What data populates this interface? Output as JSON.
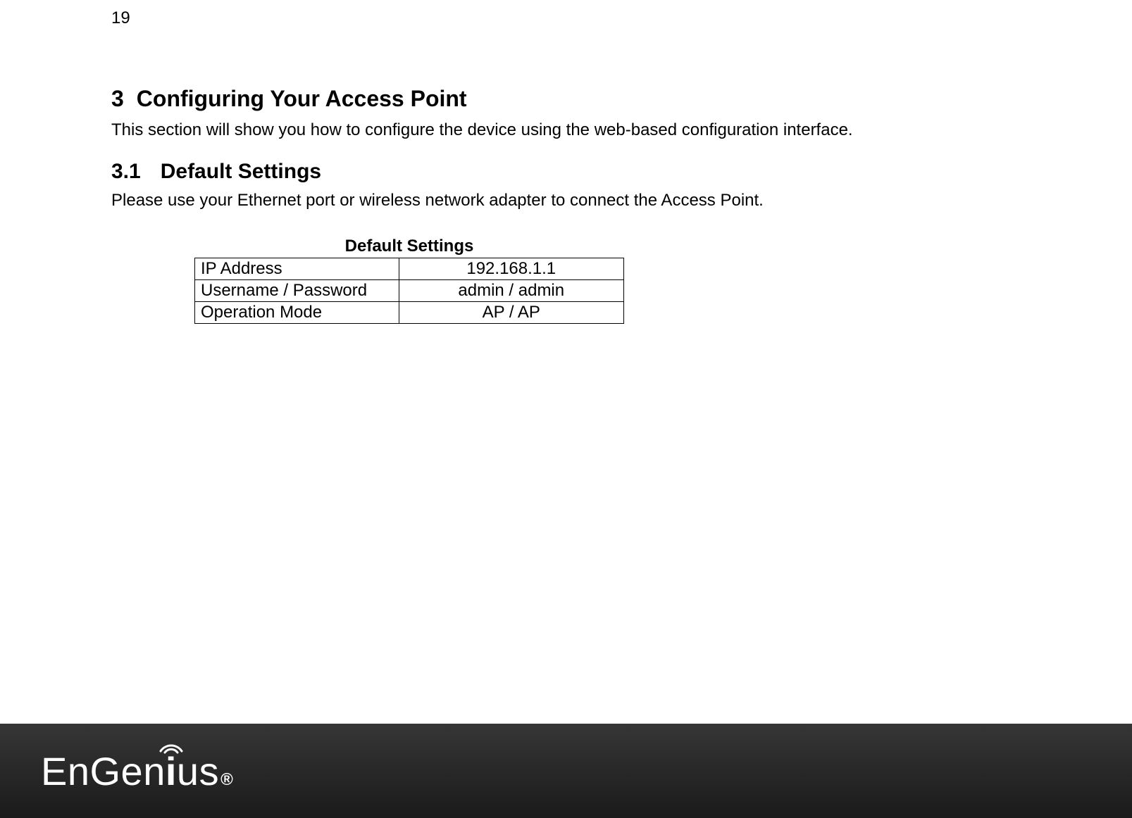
{
  "page_number": "19",
  "section": {
    "number": "3",
    "title": "Configuring Your Access Point",
    "intro": "This section will show you how to configure the device using the web-based configuration interface."
  },
  "subsection": {
    "number": "3.1",
    "title": "Default Settings",
    "intro": "Please use your Ethernet port or wireless network adapter to connect the Access Point."
  },
  "table": {
    "caption": "Default Settings",
    "rows": [
      {
        "label": "IP Address",
        "value": "192.168.1.1"
      },
      {
        "label": "Username / Password",
        "value": "admin / admin"
      },
      {
        "label": "Operation Mode",
        "value": "AP / AP"
      }
    ]
  },
  "footer": {
    "brand": "EnGenius",
    "registered": "®"
  }
}
